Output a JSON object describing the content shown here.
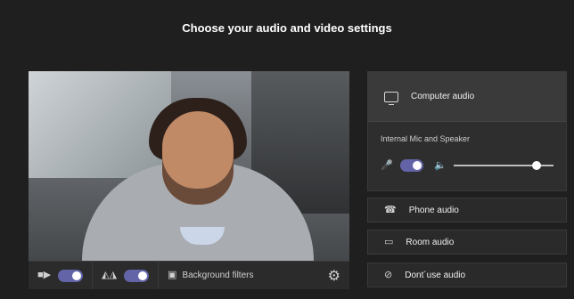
{
  "header": {
    "title": "Choose your audio and video settings"
  },
  "video": {
    "camera_toggle_on": true,
    "blur_toggle_on": true,
    "background_filters_label": "Background filters"
  },
  "audio": {
    "computer_audio_label": "Computer audio",
    "device_label": "Internal Mic and Speaker",
    "mic_toggle_on": true,
    "speaker_volume": 0.9,
    "options": [
      {
        "label": "Phone audio",
        "icon": "phone-icon"
      },
      {
        "label": "Room audio",
        "icon": "monitor-icon"
      },
      {
        "label": "Dont´use audio",
        "icon": "no-audio-icon"
      }
    ]
  },
  "colors": {
    "accent": "#6264a7",
    "background": "#1f1f1f"
  }
}
